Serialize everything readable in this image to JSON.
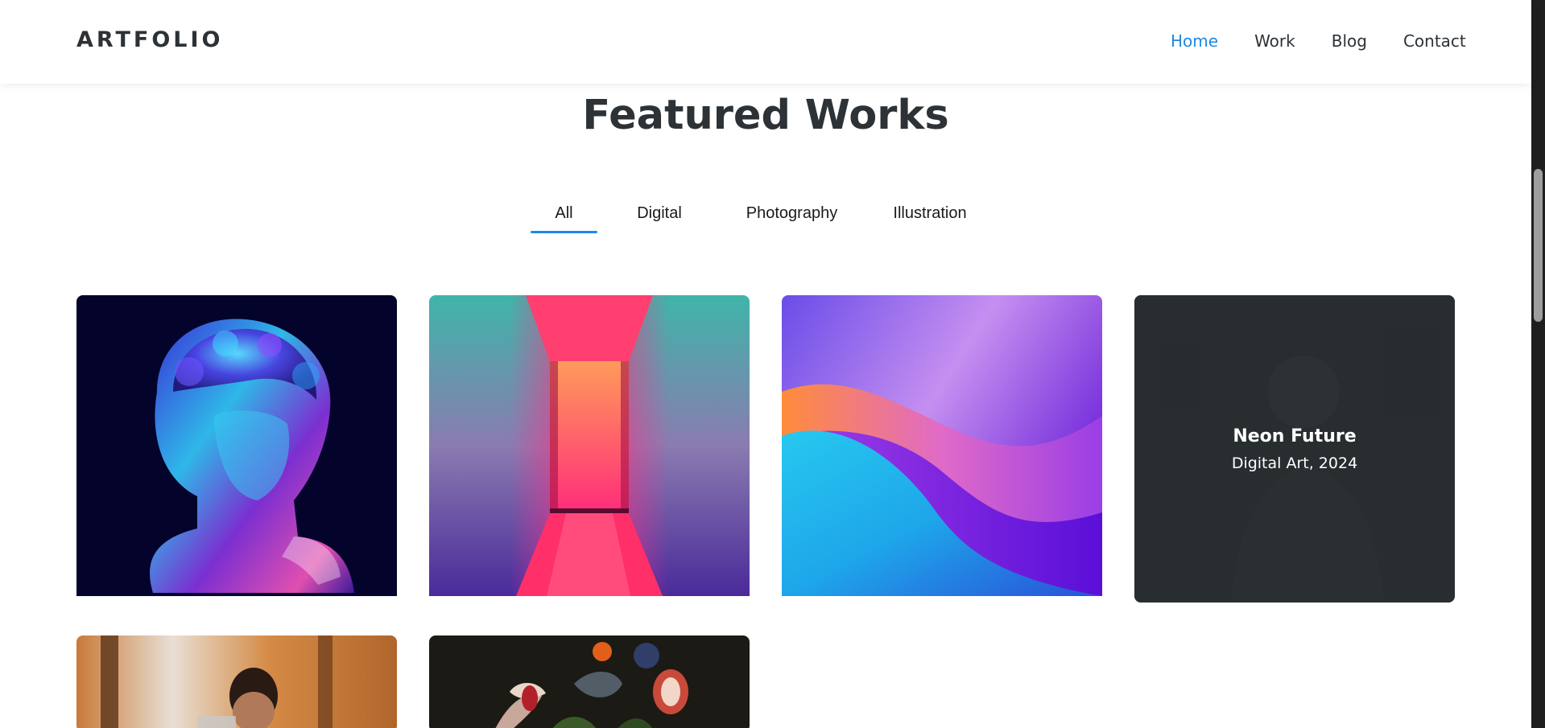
{
  "header": {
    "logo": "ARTFOLIO",
    "nav": [
      {
        "label": "Home",
        "active": true
      },
      {
        "label": "Work",
        "active": false
      },
      {
        "label": "Blog",
        "active": false
      },
      {
        "label": "Contact",
        "active": false
      }
    ]
  },
  "section": {
    "title": "Featured Works"
  },
  "filters": [
    {
      "label": "All",
      "active": true
    },
    {
      "label": "Digital",
      "active": false
    },
    {
      "label": "Photography",
      "active": false
    },
    {
      "label": "Illustration",
      "active": false
    }
  ],
  "gallery": {
    "hovered_card": {
      "title": "Neon Future",
      "subtitle": "Digital Art, 2024"
    }
  },
  "colors": {
    "accent": "#1e88e5",
    "text": "#2c3236",
    "overlay": "#24292c"
  }
}
